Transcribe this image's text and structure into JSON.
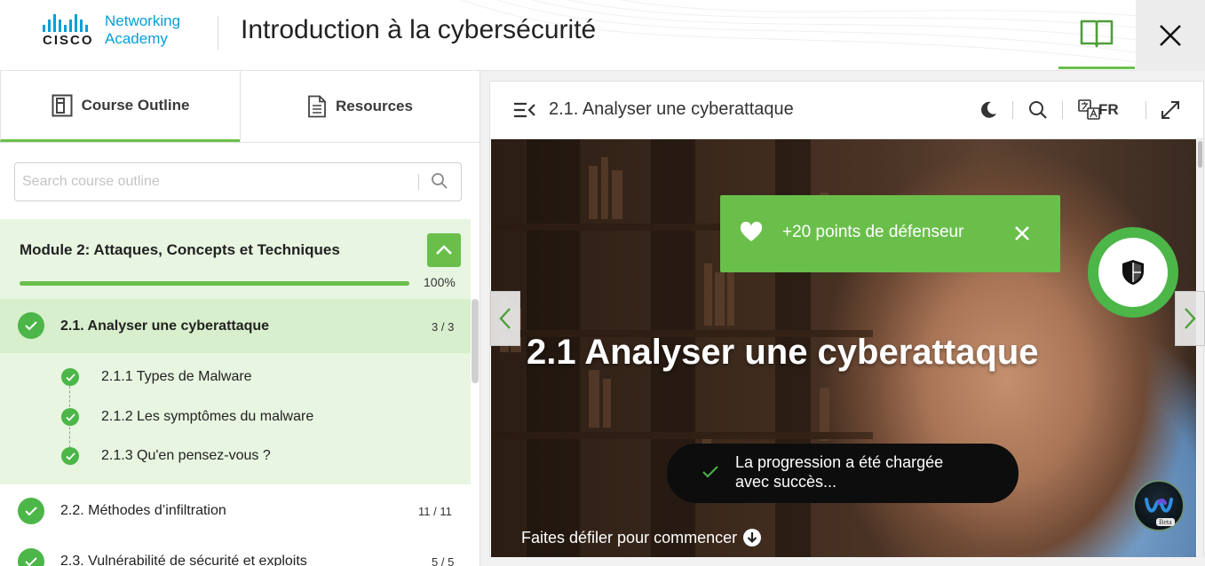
{
  "header": {
    "brand_top": "CISCO",
    "brand_line1": "Networking",
    "brand_line2": "Academy",
    "title": "Introduction à la cybersécurité",
    "book_icon": "book-open-icon",
    "close_icon": "close-icon"
  },
  "sidebar": {
    "tabs": [
      {
        "label": "Course Outline",
        "icon": "outline-icon",
        "active": true
      },
      {
        "label": "Resources",
        "icon": "document-icon",
        "active": false
      }
    ],
    "search_placeholder": "Search course outline",
    "module": {
      "title": "Module 2: Attaques, Concepts et Techniques",
      "progress_pct": 100,
      "progress_text": "100%"
    },
    "items": [
      {
        "label": "2.1. Analyser une cyberattaque",
        "count": "3 / 3",
        "active": true,
        "subitems": [
          "2.1.1 Types de Malware",
          "2.1.2 Les symptômes du malware",
          "2.1.3 Qu'en pensez-vous ?"
        ]
      },
      {
        "label": "2.2. Méthodes d’infiltration",
        "count": "11 / 11",
        "active": false
      },
      {
        "label": "2.3. Vulnérabilité de sécurité et exploits",
        "count": "5 / 5",
        "active": false
      }
    ]
  },
  "content": {
    "toolbar_title": "2.1. Analyser une cyberattaque",
    "language": "FR",
    "hero_title": "2.1 Analyser une cyberattaque",
    "scroll_hint": "Faites défiler pour commencer"
  },
  "notifications": {
    "points": "+20 points de défenseur",
    "progress_line1": "La progression a été chargée",
    "progress_line2": "avec succès..."
  },
  "webex": {
    "badge": "Beta"
  },
  "colors": {
    "accent_green": "#6abf4b",
    "check_green": "#4cb648",
    "cisco_blue": "#049fd9"
  }
}
